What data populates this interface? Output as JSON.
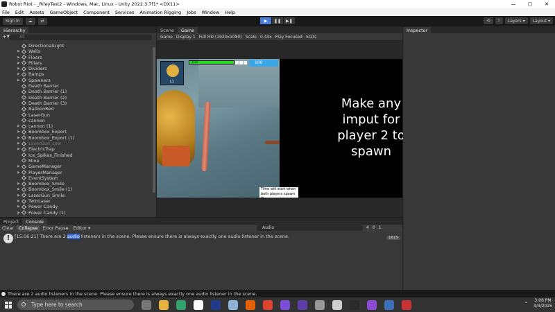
{
  "window": {
    "title": "Robot Riot - _RileyTest2 - Windows, Mac, Linux - Unity 2022.3.7f1* <DX11>",
    "controls": [
      "—",
      "▢",
      "✕"
    ]
  },
  "menu": [
    "File",
    "Edit",
    "Assets",
    "GameObject",
    "Component",
    "Services",
    "Animation Rigging",
    "Jobs",
    "Window",
    "Help"
  ],
  "toolbar": {
    "sign_in": "Sign In",
    "layers": "Layers",
    "layout": "Layout",
    "play": "▶",
    "pause": "❚❚",
    "step": "▶❚"
  },
  "hierarchy": {
    "tab": "Hierarchy",
    "search_placeholder": "All",
    "items": [
      {
        "name": "DirectionalLight",
        "arrow": "",
        "dim": false
      },
      {
        "name": "Walls",
        "arrow": "▶",
        "dim": false
      },
      {
        "name": "Floors",
        "arrow": "▶",
        "dim": false
      },
      {
        "name": "Pillars",
        "arrow": "▶",
        "dim": false
      },
      {
        "name": "Dividers",
        "arrow": "▶",
        "dim": false
      },
      {
        "name": "Ramps",
        "arrow": "▶",
        "dim": false
      },
      {
        "name": "Spawners",
        "arrow": "▶",
        "dim": false
      },
      {
        "name": "Death Barrier",
        "arrow": "",
        "dim": false
      },
      {
        "name": "Death Barrier (1)",
        "arrow": "",
        "dim": false
      },
      {
        "name": "Death Barrier (2)",
        "arrow": "",
        "dim": false
      },
      {
        "name": "Death Barrier (3)",
        "arrow": "",
        "dim": false
      },
      {
        "name": "BalloonRed",
        "arrow": "",
        "dim": false
      },
      {
        "name": "LaserGun",
        "arrow": "",
        "dim": false
      },
      {
        "name": "cannon",
        "arrow": "",
        "dim": false
      },
      {
        "name": "cannon (1)",
        "arrow": "▶",
        "dim": false
      },
      {
        "name": "Boombox_Export",
        "arrow": "▶",
        "dim": false
      },
      {
        "name": "Boombox_Export (1)",
        "arrow": "▶",
        "dim": false
      },
      {
        "name": "LaserGun_Low",
        "arrow": "▶",
        "dim": true
      },
      {
        "name": "ElectricTrap",
        "arrow": "▶",
        "dim": false
      },
      {
        "name": "Ice_Spikes_Finished",
        "arrow": "",
        "dim": false
      },
      {
        "name": "Mine",
        "arrow": "",
        "dim": false
      },
      {
        "name": "GameManager",
        "arrow": "▶",
        "dim": false
      },
      {
        "name": "PlayerManager",
        "arrow": "▶",
        "dim": false
      },
      {
        "name": "EventSystem",
        "arrow": "",
        "dim": false
      },
      {
        "name": "Boombox_Smile",
        "arrow": "▶",
        "dim": false
      },
      {
        "name": "Boombox_Smile (1)",
        "arrow": "▶",
        "dim": false
      },
      {
        "name": "LaserGun_Smile",
        "arrow": "▶",
        "dim": false
      },
      {
        "name": "TwinLaser",
        "arrow": "▶",
        "dim": false
      },
      {
        "name": "Power Candy",
        "arrow": "▶",
        "dim": false
      },
      {
        "name": "Power Candy (1)",
        "arrow": "▶",
        "dim": false
      },
      {
        "name": "Power Candy (2)",
        "arrow": "▶",
        "dim": false
      }
    ]
  },
  "scene_tabs": {
    "scene": "Scene",
    "game": "Game"
  },
  "game_bar": {
    "mode": "Game",
    "display": "Display 1",
    "resolution": "Full HD (1920x1080)",
    "scale_label": "Scale",
    "scale_value": "0.44x",
    "play_focused": "Play Focused",
    "stats": "Stats"
  },
  "game_view": {
    "hp_text": "100",
    "score": "100",
    "level": "L1",
    "time_note": "Time will start when both players spawn in",
    "spawn_message": "Make any imput for player 2 to spawn"
  },
  "inspector": {
    "tab": "Inspector"
  },
  "console": {
    "tabs": {
      "project": "Project",
      "console": "Console"
    },
    "buttons": {
      "clear": "Clear",
      "collapse": "Collapse",
      "error_pause": "Error Pause",
      "editor": "Editor ▾"
    },
    "search_value": "Audio",
    "counts": {
      "info": "4",
      "warn": "0",
      "error": "1"
    },
    "log": {
      "prefix": "[15:06:21] There are 2 ",
      "highlight": "audio",
      "suffix": " listeners in the scene. Please ensure there is always exactly one audio listener in the scene.",
      "count": "1615"
    }
  },
  "status": {
    "message": "There are 2 audio listeners in the scene. Please ensure there is always exactly one audio listener in the scene."
  },
  "taskbar": {
    "search_placeholder": "Type here to search",
    "time": "3:06 PM",
    "date": "4/3/2025"
  },
  "colors": {
    "accent": "#4a7ed8",
    "hp": "#22dd22",
    "score": "#3aa6e6",
    "highlight": "#2f65ca"
  }
}
